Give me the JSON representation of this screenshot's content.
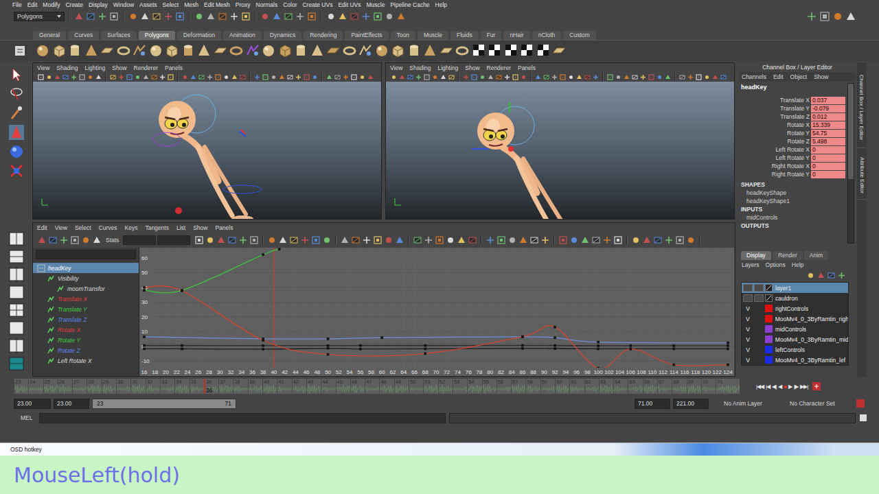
{
  "menubar": [
    "File",
    "Edit",
    "Modify",
    "Create",
    "Display",
    "Window",
    "Assets",
    "Select",
    "Mesh",
    "Edit Mesh",
    "Proxy",
    "Normals",
    "Color",
    "Create UVs",
    "Edit UVs",
    "Muscle",
    "Pipeline Cache",
    "Help"
  ],
  "status_line": {
    "mode": "Polygons"
  },
  "shelf_tabs": [
    {
      "label": "General",
      "selected": false
    },
    {
      "label": "Curves",
      "selected": false
    },
    {
      "label": "Surfaces",
      "selected": false
    },
    {
      "label": "Polygons",
      "selected": true
    },
    {
      "label": "Deformation",
      "selected": false
    },
    {
      "label": "Animation",
      "selected": false
    },
    {
      "label": "Dynamics",
      "selected": false
    },
    {
      "label": "Rendering",
      "selected": false
    },
    {
      "label": "PaintEffects",
      "selected": false
    },
    {
      "label": "Toon",
      "selected": false
    },
    {
      "label": "Muscle",
      "selected": false
    },
    {
      "label": "Fluids",
      "selected": false
    },
    {
      "label": "Fur",
      "selected": false
    },
    {
      "label": "nHair",
      "selected": false
    },
    {
      "label": "nCloth",
      "selected": false
    },
    {
      "label": "Custom",
      "selected": false
    }
  ],
  "viewports": [
    {
      "menu": [
        "View",
        "Shading",
        "Lighting",
        "Show",
        "Renderer",
        "Panels"
      ]
    },
    {
      "menu": [
        "View",
        "Shading",
        "Lighting",
        "Show",
        "Renderer",
        "Panels"
      ]
    }
  ],
  "graph_editor": {
    "menu": [
      "Edit",
      "View",
      "Select",
      "Curves",
      "Keys",
      "Tangents",
      "List",
      "Show",
      "Panels"
    ],
    "stats_label": "Stats",
    "outliner": [
      {
        "label": "headKey",
        "depth": 0,
        "selected": true,
        "color": "#ffffff"
      },
      {
        "label": "Visibility",
        "depth": 1,
        "selected": false,
        "color": "#dddddd"
      },
      {
        "label": "moomTransfor",
        "depth": 2,
        "selected": false,
        "color": "#dddddd"
      },
      {
        "label": "Translate X",
        "depth": 1,
        "selected": false,
        "color": "#e03c3c"
      },
      {
        "label": "Translate Y",
        "depth": 1,
        "selected": false,
        "color": "#3ccf3c"
      },
      {
        "label": "Translate Z",
        "depth": 1,
        "selected": false,
        "color": "#5a86f0"
      },
      {
        "label": "Rotate X",
        "depth": 1,
        "selected": false,
        "color": "#e03c3c"
      },
      {
        "label": "Rotate Y",
        "depth": 1,
        "selected": false,
        "color": "#3ccf3c"
      },
      {
        "label": "Rotate Z",
        "depth": 1,
        "selected": false,
        "color": "#5a86f0"
      },
      {
        "label": "Left Rotate X",
        "depth": 1,
        "selected": false,
        "color": "#dddddd"
      }
    ],
    "y_ticks": [
      "60",
      "50",
      "40",
      "30",
      "20",
      "10",
      "0",
      "-10"
    ],
    "x_ticks": [
      "16",
      "18",
      "20",
      "22",
      "24",
      "26",
      "28",
      "30",
      "32",
      "34",
      "36",
      "38",
      "40",
      "42",
      "44",
      "46",
      "48",
      "50",
      "52",
      "54",
      "56",
      "58",
      "60",
      "62",
      "64",
      "66",
      "68",
      "70",
      "72",
      "74",
      "76",
      "78",
      "80",
      "82",
      "84",
      "86",
      "88",
      "90",
      "92",
      "94",
      "96",
      "98",
      "100",
      "102",
      "104",
      "106",
      "108",
      "110",
      "112",
      "114",
      "116",
      "118",
      "120",
      "122",
      "124"
    ],
    "current_frame": 40,
    "series": [
      {
        "name": "Translate X",
        "color": "#2a2a2a",
        "frames": [
          16,
          23,
          38,
          50,
          56,
          68,
          86,
          92,
          100,
          106,
          114,
          124
        ],
        "values": [
          0.5,
          0.5,
          0.4,
          0.4,
          0.5,
          0.5,
          0.6,
          0.5,
          0.3,
          0.3,
          0.3,
          0.3
        ]
      },
      {
        "name": "Translate Y",
        "color": "#1c1c1c",
        "frames": [
          16,
          23,
          38,
          50,
          56,
          68,
          86,
          92,
          100,
          106,
          114,
          124
        ],
        "values": [
          -1.8,
          -1.8,
          -2,
          -1.5,
          -1.9,
          -1.8,
          -1.5,
          -1.6,
          -1.8,
          -1.8,
          -1.8,
          -1.8
        ]
      },
      {
        "name": "Rotate Z",
        "color": "#6f8fd8",
        "frames": [
          16,
          38,
          50,
          60,
          86,
          92,
          100,
          124
        ],
        "values": [
          6.4,
          5,
          5,
          5.8,
          6.4,
          5.8,
          2.8,
          2.3
        ]
      },
      {
        "name": "Rotate Y",
        "color": "#3cc43c",
        "frames": [
          16,
          23,
          38,
          41
        ],
        "values": [
          38,
          38,
          62.3,
          66
        ]
      },
      {
        "name": "Rotate X",
        "color": "#d2442f",
        "frames": [
          16,
          23,
          38,
          50,
          68,
          86,
          92,
          100,
          106,
          114,
          124
        ],
        "values": [
          40,
          37.7,
          4,
          -5.6,
          -5,
          6.5,
          13,
          -15,
          -1.9,
          -12.6,
          -12.6
        ]
      }
    ]
  },
  "channel_box": {
    "title": "Channel Box / Layer Editor",
    "menu": [
      "Channels",
      "Edit",
      "Object",
      "Show"
    ],
    "node": "headKey",
    "attributes": [
      {
        "name": "Translate X",
        "value": "0.037",
        "keyed": true
      },
      {
        "name": "Translate Y",
        "value": "-0.079",
        "keyed": true
      },
      {
        "name": "Translate Z",
        "value": "0.012",
        "keyed": true
      },
      {
        "name": "Rotate X",
        "value": "15.339",
        "keyed": true
      },
      {
        "name": "Rotate Y",
        "value": "54.75",
        "keyed": true
      },
      {
        "name": "Rotate Z",
        "value": "5.498",
        "keyed": true
      },
      {
        "name": "Left Rotate X",
        "value": "0",
        "keyed": true
      },
      {
        "name": "Left Rotate Y",
        "value": "0",
        "keyed": true
      },
      {
        "name": "Right Rotate X",
        "value": "0",
        "keyed": true
      },
      {
        "name": "Right Rotate Y",
        "value": "0",
        "keyed": true
      }
    ],
    "shapes_label": "SHAPES",
    "shapes": [
      "headKeyShape",
      "headKeyShape1"
    ],
    "inputs_label": "INPUTS",
    "inputs": [
      "midControls"
    ],
    "outputs_label": "OUTPUTS"
  },
  "side_tabs": [
    "Channel Box / Layer Editor",
    "Attribute Editor"
  ],
  "layer_editor": {
    "tabs": [
      {
        "label": "Display",
        "selected": true
      },
      {
        "label": "Render",
        "selected": false
      },
      {
        "label": "Anim",
        "selected": false
      }
    ],
    "menu": [
      "Layers",
      "Options",
      "Help"
    ],
    "v_label": "V",
    "layers": [
      {
        "name": "layer1",
        "visible": false,
        "selected": true,
        "color": ""
      },
      {
        "name": "cauldron",
        "visible": false,
        "selected": false,
        "color": ""
      },
      {
        "name": "rightControls",
        "visible": true,
        "selected": false,
        "color": "#e01010"
      },
      {
        "name": "MooMv4_0_3ByRamtin_righ",
        "visible": true,
        "selected": false,
        "color": "#e01010"
      },
      {
        "name": "midControls",
        "visible": true,
        "selected": false,
        "color": "#8a3fd0"
      },
      {
        "name": "MooMv4_0_3ByRamtin_mid",
        "visible": true,
        "selected": false,
        "color": "#8a3fd0"
      },
      {
        "name": "leftControls",
        "visible": true,
        "selected": false,
        "color": "#1a2ae8"
      },
      {
        "name": "MooMv4_0_3ByRamtin_lef",
        "visible": true,
        "selected": false,
        "color": "#1a2ae8"
      }
    ]
  },
  "time_slider": {
    "ticks": [
      "23",
      "24",
      "25",
      "26",
      "27",
      "28",
      "29",
      "30",
      "31",
      "32",
      "33",
      "34",
      "35",
      "36",
      "37",
      "38",
      "39",
      "40",
      "41",
      "42",
      "43",
      "44",
      "45",
      "46",
      "47",
      "48",
      "49",
      "50",
      "51",
      "52",
      "53",
      "54",
      "55",
      "56",
      "57",
      "58",
      "59",
      "60",
      "61",
      "62",
      "63",
      "64",
      "65",
      "66",
      "67",
      "68",
      "69",
      "70",
      "71"
    ],
    "current": "36"
  },
  "playback_buttons": [
    "|◀◀",
    "|◀",
    "◀|",
    "◀",
    "■",
    "▶",
    "|▶",
    "▶▶|"
  ],
  "range_slider": {
    "start": "23.00",
    "range_start": "23.00",
    "inner_start": "23",
    "inner_end": "71",
    "range_end": "71.00",
    "end": "221.00"
  },
  "anim_layer": "No Anim Layer",
  "character_set": "No Character Set",
  "command_line": {
    "label": "MEL"
  },
  "osd": {
    "title": "OSD hotkey",
    "text": "MouseLeft(hold)"
  }
}
